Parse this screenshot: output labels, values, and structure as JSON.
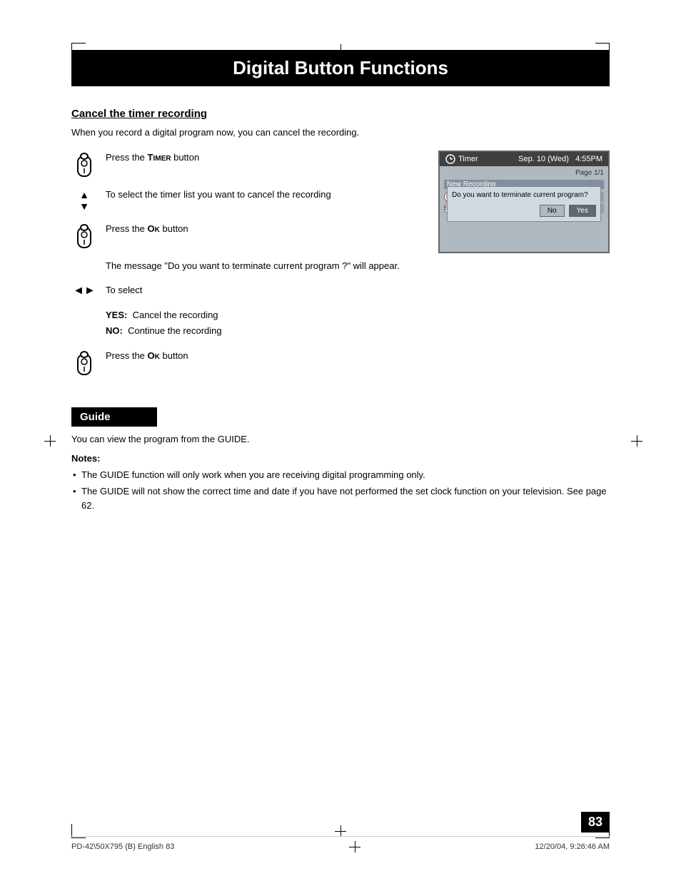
{
  "page": {
    "title": "Digital Button Functions",
    "number": "83",
    "footer_left": "PD-42\\50X795 (B) English  83",
    "footer_right": "12/20/04, 9:26:46 AM"
  },
  "cancel_section": {
    "heading": "Cancel the timer recording",
    "intro": "When you record a digital program now, you can cancel the recording.",
    "steps": [
      {
        "icon": "remote",
        "text": "Press the TIMER button"
      },
      {
        "icon": "arrow-ud",
        "text": "To select the timer list you want to cancel the recording"
      },
      {
        "icon": "remote",
        "text": "Press the OK button"
      },
      {
        "icon": null,
        "text": "The message \"Do you want to terminate current program ?\" will appear."
      },
      {
        "icon": "arrow-lr",
        "text": "To select"
      }
    ],
    "yes_no": {
      "yes_label": "YES:",
      "yes_text": "Cancel the recording",
      "no_label": "NO:",
      "no_text": "Continue the recording"
    },
    "last_step": {
      "icon": "remote",
      "text": "Press the OK button"
    }
  },
  "screen": {
    "header_icon": "timer-icon",
    "header_title": "Timer",
    "header_date": "Sep. 10 (Wed)",
    "header_time": "4:55PM",
    "page_label": "Page 1/1",
    "section_label": "New Recording",
    "dialog_text": "Do you want to terminate current program?",
    "dialog_no": "No",
    "dialog_yes": "Yes"
  },
  "guide_section": {
    "heading": "Guide",
    "text": "You can view the program from the GUIDE.",
    "notes_title": "Notes:",
    "notes": [
      "The GUIDE function will only work when you are receiving digital programming only.",
      "The GUIDE will not show the correct time and date if you have not performed the set clock function on your television.  See page 62."
    ]
  }
}
